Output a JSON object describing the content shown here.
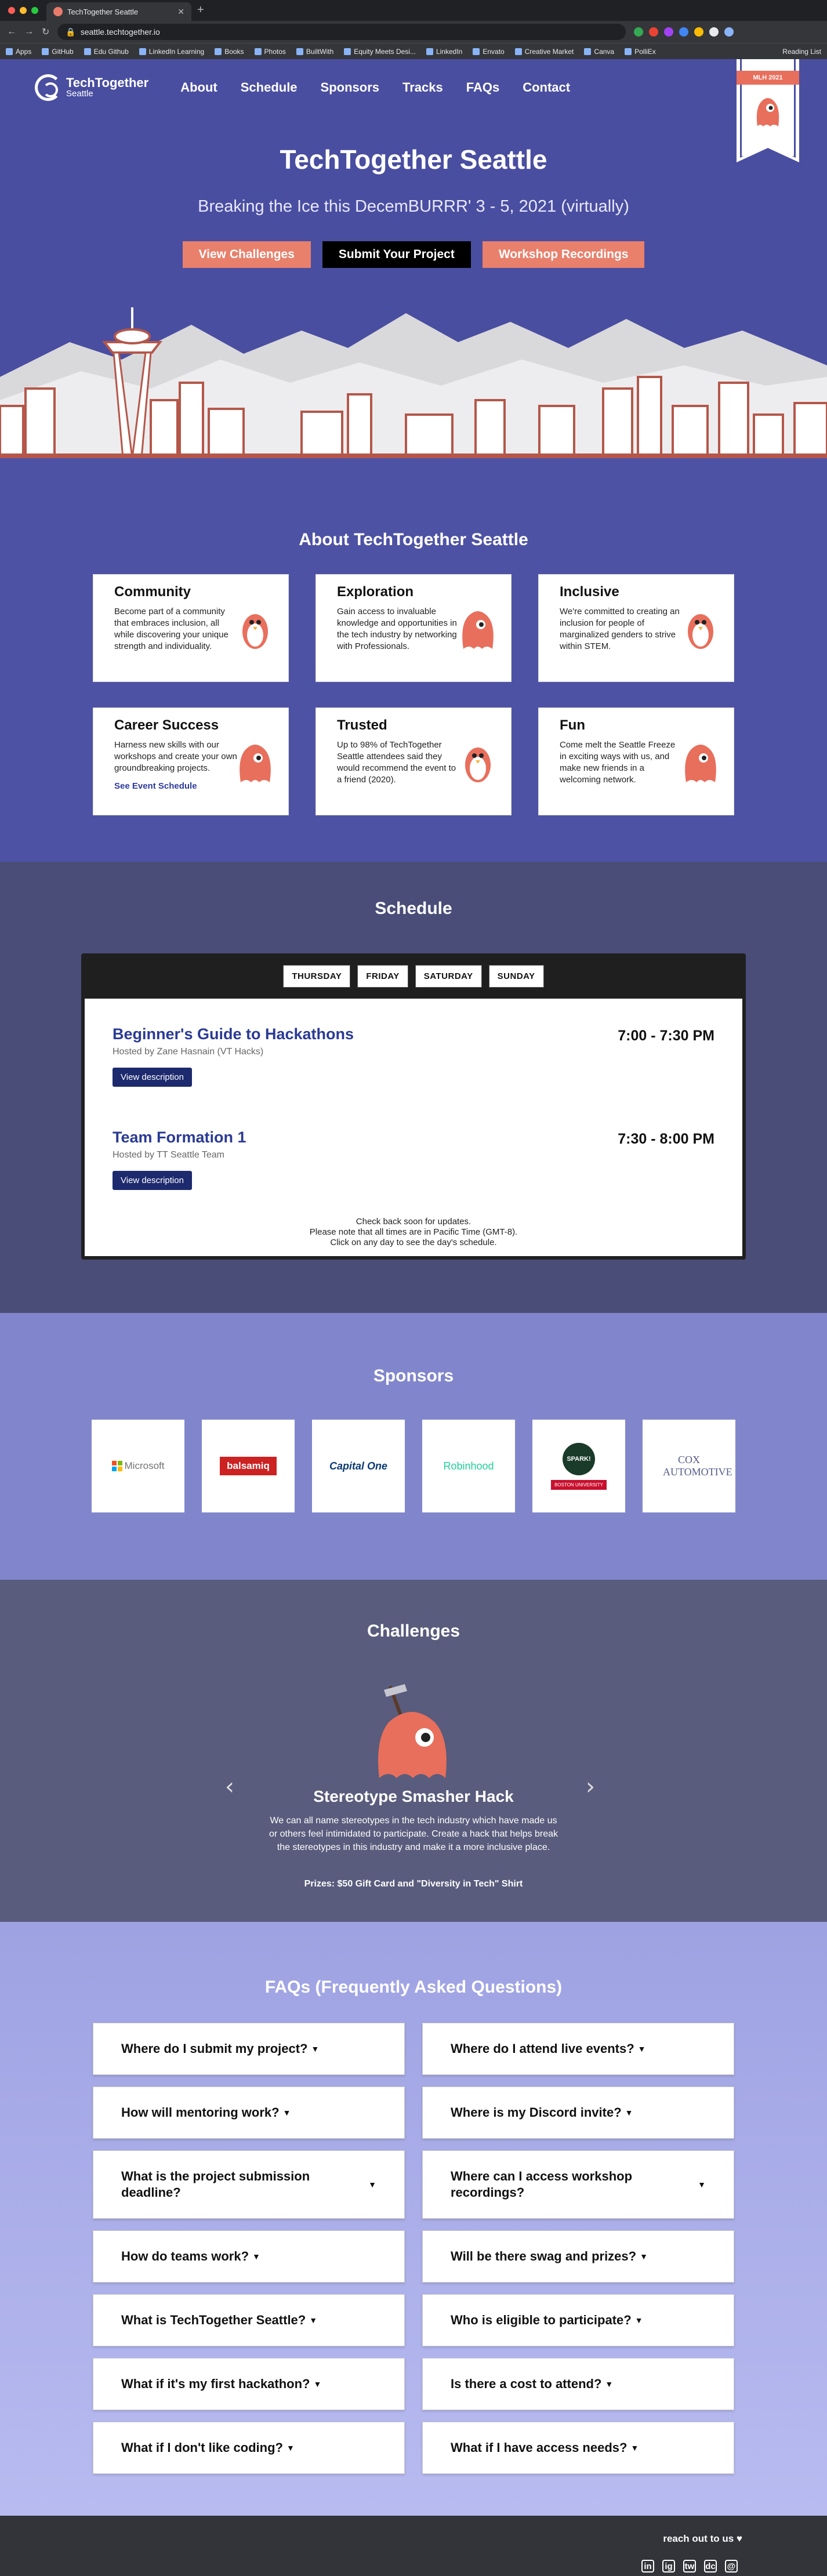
{
  "browser": {
    "tab_title": "TechTogether Seattle",
    "url": "seattle.techtogether.io",
    "bookmarks": [
      "Apps",
      "GitHub",
      "Edu Github",
      "LinkedIn Learning",
      "Books",
      "Photos",
      "BuiltWith",
      "Equity Meets Desi...",
      "LinkedIn",
      "Envato",
      "Creative Market",
      "Canva",
      "PolliEx"
    ],
    "reading_list": "Reading List"
  },
  "nav": {
    "logo_title": "TechTogether",
    "logo_sub": "Seattle",
    "links": [
      "About",
      "Schedule",
      "Sponsors",
      "Tracks",
      "FAQs",
      "Contact"
    ],
    "banner_text": "MLH 2021"
  },
  "hero": {
    "title": "TechTogether Seattle",
    "tagline": "Breaking the Ice this DecemBURRR' 3 - 5, 2021 (virtually)",
    "buttons": [
      "View Challenges",
      "Submit Your Project",
      "Workshop Recordings"
    ]
  },
  "about": {
    "title": "About TechTogether Seattle",
    "cards": [
      {
        "title": "Community",
        "text": "Become part of a community that embraces inclusion, all while discovering your unique strength and individuality.",
        "link": ""
      },
      {
        "title": "Exploration",
        "text": "Gain access to invaluable knowledge and opportunities in the tech industry by networking with Professionals.",
        "link": ""
      },
      {
        "title": "Inclusive",
        "text": "We're committed to creating an inclusion for people of marginalized genders to strive within STEM.",
        "link": ""
      },
      {
        "title": "Career Success",
        "text": "Harness new skills with our workshops and create your own groundbreaking projects.",
        "link": "See Event Schedule"
      },
      {
        "title": "Trusted",
        "text": "Up to 98% of TechTogether Seattle attendees said they would recommend the event to a friend (2020).",
        "link": ""
      },
      {
        "title": "Fun",
        "text": "Come melt the Seattle Freeze in exciting ways with us, and make new friends in a welcoming network.",
        "link": ""
      }
    ]
  },
  "schedule": {
    "title": "Schedule",
    "days": [
      "THURSDAY",
      "FRIDAY",
      "SATURDAY",
      "SUNDAY"
    ],
    "events": [
      {
        "title": "Beginner's Guide to Hackathons",
        "host": "Hosted by Zane Hasnain (VT Hacks)",
        "time": "7:00 - 7:30 PM",
        "button": "View description"
      },
      {
        "title": "Team Formation 1",
        "host": "Hosted by TT Seattle Team",
        "time": "7:30 - 8:00 PM",
        "button": "View description"
      }
    ],
    "note_lines": [
      "Check back soon for updates.",
      "Please note that all times are in Pacific Time (GMT-8).",
      "Click on any day to see the day's schedule."
    ]
  },
  "sponsors": {
    "title": "Sponsors",
    "items": [
      {
        "name": "Microsoft",
        "color": "#737373"
      },
      {
        "name": "balsamiq",
        "color": "#cc2222"
      },
      {
        "name": "Capital One",
        "color": "#0b3a75"
      },
      {
        "name": "Robinhood",
        "color": "#21ce99"
      },
      {
        "name": "SPARK!",
        "color": "#1a3a2a"
      },
      {
        "name": "COX AUTOMOTIVE",
        "color": "#555a8a"
      }
    ],
    "spark_sub": "BOSTON UNIVERSITY"
  },
  "challenges": {
    "title": "Challenges",
    "name": "Stereotype Smasher Hack",
    "description": "We can all name stereotypes in the tech industry which have made us or others feel intimidated to participate. Create a hack that helps break the stereotypes in this industry and make it a more inclusive place.",
    "prize": "Prizes: $50 Gift Card and \"Diversity in Tech\" Shirt",
    "prev": "‹",
    "next": "›"
  },
  "faq": {
    "title": "FAQs (Frequently Asked Questions)",
    "left": [
      "Where do I submit my project?",
      "How will mentoring work?",
      "What is the project submission deadline?",
      "How do teams work?",
      "What is TechTogether Seattle?",
      "What if it's my first hackathon?",
      "What if I don't like coding?"
    ],
    "right": [
      "Where do I attend live events?",
      "Where is my Discord invite?",
      "Where can I access workshop recordings?",
      "Will be there swag and prizes?",
      "Who is eligible to participate?",
      "Is there a cost to attend?",
      "What if I have access needs?"
    ]
  },
  "footer": {
    "reach": "reach out to us ♥",
    "socials": [
      "in",
      "ig",
      "tw",
      "dc",
      "@"
    ]
  },
  "colors": {
    "hero_bg": "#4a4ea0",
    "accent_coral": "#e8806c",
    "event_title": "#2a3a94"
  }
}
